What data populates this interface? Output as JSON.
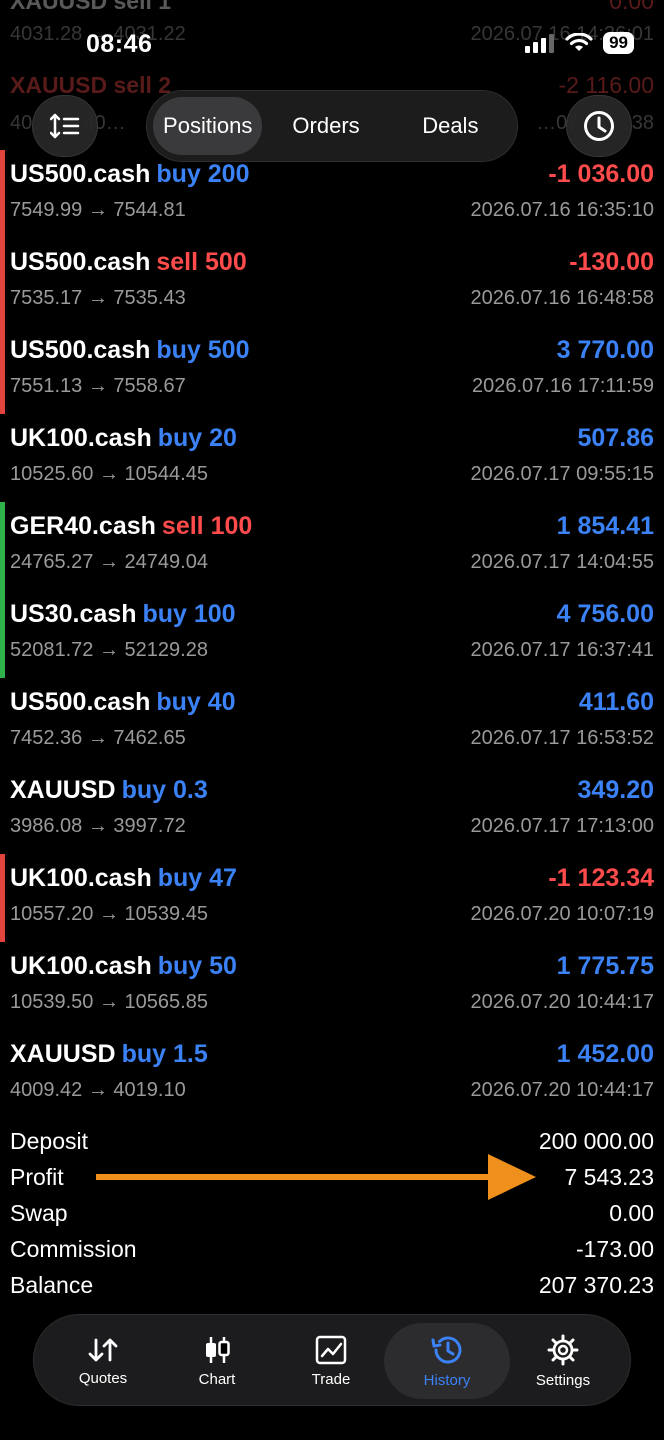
{
  "status_bar": {
    "time": "08:46",
    "battery": "99"
  },
  "ghost_rows": [
    {
      "symbol": "XAUUSD sell 1",
      "profit": "0.00",
      "prices": "4031.28 → 4031.22",
      "time": "2026.07.16 14:36:01"
    },
    {
      "symbol": "XAUUSD sell 2",
      "profit": "-2 116.00",
      "prices": "40…    → 40…",
      "time": "…07.16 …38"
    }
  ],
  "top_bar": {
    "tabs": [
      "Positions",
      "Orders",
      "Deals"
    ],
    "active_tab": "Positions"
  },
  "deals": [
    {
      "symbol": "US500.cash",
      "side": "buy",
      "volume": "buy 200",
      "profit": "-1 036.00",
      "profit_sign": "neg",
      "prices": "7549.99 → 7544.81",
      "time": "2026.07.16 16:35:10",
      "bar_color": "#e0443c"
    },
    {
      "symbol": "US500.cash",
      "side": "sell",
      "volume": "sell 500",
      "profit": "-130.00",
      "profit_sign": "neg",
      "prices": "7535.17 → 7535.43",
      "time": "2026.07.16 16:48:58",
      "bar_color": "#e0443c"
    },
    {
      "symbol": "US500.cash",
      "side": "buy",
      "volume": "buy 500",
      "profit": "3 770.00",
      "profit_sign": "pos",
      "prices": "7551.13 → 7558.67",
      "time": "2026.07.16 17:11:59",
      "bar_color": "#e0443c"
    },
    {
      "symbol": "UK100.cash",
      "side": "buy",
      "volume": "buy 20",
      "profit": "507.86",
      "profit_sign": "pos",
      "prices": "10525.60 → 10544.45",
      "time": "2026.07.17 09:55:15",
      "bar_color": ""
    },
    {
      "symbol": "GER40.cash",
      "side": "sell",
      "volume": "sell 100",
      "profit": "1 854.41",
      "profit_sign": "pos",
      "prices": "24765.27 → 24749.04",
      "time": "2026.07.17 14:04:55",
      "bar_color": "#2fb24c"
    },
    {
      "symbol": "US30.cash",
      "side": "buy",
      "volume": "buy 100",
      "profit": "4 756.00",
      "profit_sign": "pos",
      "prices": "52081.72 → 52129.28",
      "time": "2026.07.17 16:37:41",
      "bar_color": "#2fb24c"
    },
    {
      "symbol": "US500.cash",
      "side": "buy",
      "volume": "buy 40",
      "profit": "411.60",
      "profit_sign": "pos",
      "prices": "7452.36 → 7462.65",
      "time": "2026.07.17 16:53:52",
      "bar_color": ""
    },
    {
      "symbol": "XAUUSD",
      "side": "buy",
      "volume": "buy 0.3",
      "profit": "349.20",
      "profit_sign": "pos",
      "prices": "3986.08 → 3997.72",
      "time": "2026.07.17 17:13:00",
      "bar_color": ""
    },
    {
      "symbol": "UK100.cash",
      "side": "buy",
      "volume": "buy 47",
      "profit": "-1 123.34",
      "profit_sign": "neg",
      "prices": "10557.20 → 10539.45",
      "time": "2026.07.20 10:07:19",
      "bar_color": "#e0443c"
    },
    {
      "symbol": "UK100.cash",
      "side": "buy",
      "volume": "buy 50",
      "profit": "1 775.75",
      "profit_sign": "pos",
      "prices": "10539.50 → 10565.85",
      "time": "2026.07.20 10:44:17",
      "bar_color": ""
    },
    {
      "symbol": "XAUUSD",
      "side": "buy",
      "volume": "buy 1.5",
      "profit": "1 452.00",
      "profit_sign": "pos",
      "prices": "4009.42 → 4019.10",
      "time": "2026.07.20 10:44:17",
      "bar_color": ""
    }
  ],
  "summary": [
    {
      "key": "deposit",
      "label": "Deposit",
      "value": "200 000.00"
    },
    {
      "key": "profit",
      "label": "Profit",
      "value": "7 543.23"
    },
    {
      "key": "swap",
      "label": "Swap",
      "value": "0.00"
    },
    {
      "key": "commission",
      "label": "Commission",
      "value": "-173.00"
    },
    {
      "key": "balance",
      "label": "Balance",
      "value": "207 370.23"
    }
  ],
  "annotation": {
    "arrow_color": "#f0901c"
  },
  "tab_bar": {
    "items": [
      {
        "key": "quotes",
        "label": "Quotes",
        "icon": "quotes-arrows-icon"
      },
      {
        "key": "chart",
        "label": "Chart",
        "icon": "candlestick-chart-icon"
      },
      {
        "key": "trade",
        "label": "Trade",
        "icon": "trade-chart-icon"
      },
      {
        "key": "history",
        "label": "History",
        "icon": "history-clock-icon"
      },
      {
        "key": "settings",
        "label": "Settings",
        "icon": "gear-icon"
      }
    ],
    "active": "history"
  },
  "colors": {
    "buy": "#3b82f6",
    "sell": "#ff4b4b",
    "accent": "#3b82f6"
  }
}
